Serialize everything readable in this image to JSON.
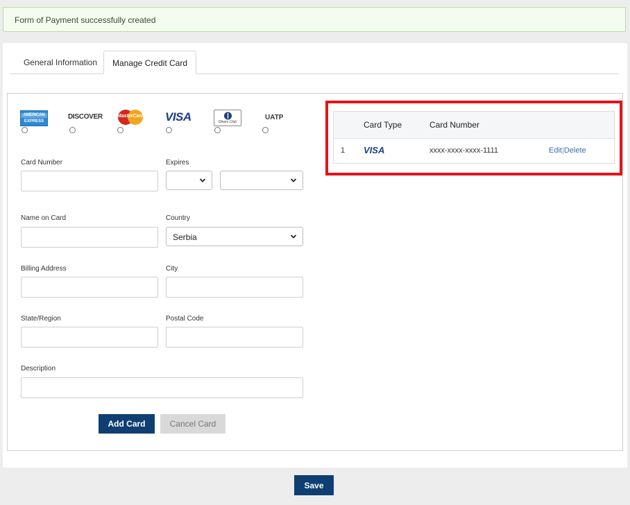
{
  "alert": {
    "message": "Form of Payment successfully created"
  },
  "tabs": [
    {
      "label": "General Information"
    },
    {
      "label": "Manage Credit Card"
    }
  ],
  "card_types": [
    {
      "name": "American Express",
      "text_top": "AMERICAN",
      "text_bottom": "EXPRESS"
    },
    {
      "name": "Discover",
      "text": "DISCOVER"
    },
    {
      "name": "MasterCard",
      "text": "MasterCard"
    },
    {
      "name": "Visa",
      "text": "VISA"
    },
    {
      "name": "Diners Club",
      "text": "Diners Club"
    },
    {
      "name": "UATP",
      "text": "UATP"
    }
  ],
  "form": {
    "card_number_label": "Card Number",
    "expires_label": "Expires",
    "name_label": "Name on Card",
    "country_label": "Country",
    "country_value": "Serbia",
    "billing_label": "Billing Address",
    "city_label": "City",
    "state_label": "State/Region",
    "postal_label": "Postal Code",
    "description_label": "Description",
    "add_label": "Add Card",
    "cancel_label": "Cancel Card"
  },
  "table": {
    "headers": [
      "Card Type",
      "Card Number"
    ],
    "rows": [
      {
        "index": "1",
        "card_type": "VISA",
        "card_number": "xxxx-xxxx-xxxx-1111",
        "edit": "Edit",
        "separator": "|",
        "delete": "Delete"
      }
    ]
  },
  "footer": {
    "save_label": "Save"
  },
  "colors": {
    "primary": "#0f3f72",
    "highlight": "#e5131b",
    "link": "#3f6fae",
    "alert_bg": "#f4fbef"
  }
}
